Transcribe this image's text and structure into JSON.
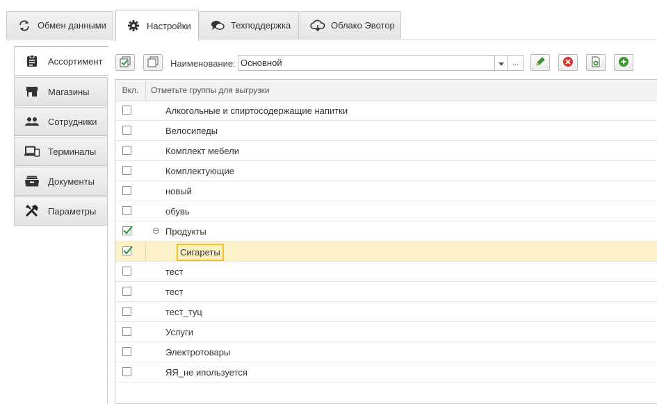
{
  "top_tabs": [
    {
      "label": "Обмен данными",
      "icon": "sync-icon"
    },
    {
      "label": "Настройки",
      "icon": "gear-icon",
      "active": true
    },
    {
      "label": "Техподдержка",
      "icon": "chat-icon"
    },
    {
      "label": "Облако Эвотор",
      "icon": "cloud-icon"
    }
  ],
  "side_tabs": [
    {
      "label": "Ассортимент",
      "icon": "clipboard-icon",
      "active": true
    },
    {
      "label": "Магазины",
      "icon": "store-icon"
    },
    {
      "label": "Сотрудники",
      "icon": "people-icon"
    },
    {
      "label": "Терминалы",
      "icon": "devices-icon"
    },
    {
      "label": "Документы",
      "icon": "archive-icon"
    },
    {
      "label": "Параметры",
      "icon": "tools-icon"
    }
  ],
  "toolbar": {
    "name_label": "Наименование:",
    "name_value": "Основной",
    "more_label": "...",
    "check_all_icon": "check-all-icon",
    "uncheck_all_icon": "uncheck-all-icon",
    "edit_icon": "pencil-icon",
    "delete_icon": "delete-icon",
    "copy_icon": "copy-doc-icon",
    "add_icon": "add-icon"
  },
  "grid": {
    "col_enabled": "Вкл.",
    "col_groups": "Отметьте группы для выгрузки",
    "rows": [
      {
        "label": "Алкогольные и спиртосодержащие напитки",
        "checked": false,
        "level": 0
      },
      {
        "label": "Велосипеды",
        "checked": false,
        "level": 0
      },
      {
        "label": "Комплект мебели",
        "checked": false,
        "level": 0
      },
      {
        "label": "Комплектующие",
        "checked": false,
        "level": 0
      },
      {
        "label": "новый",
        "checked": false,
        "level": 0
      },
      {
        "label": "обувь",
        "checked": false,
        "level": 0
      },
      {
        "label": "Продукты",
        "checked": true,
        "level": 0,
        "expanded": true
      },
      {
        "label": "Сигареты",
        "checked": true,
        "level": 1,
        "selected": true
      },
      {
        "label": "тест",
        "checked": false,
        "level": 0
      },
      {
        "label": "тест",
        "checked": false,
        "level": 0
      },
      {
        "label": "тест_туц",
        "checked": false,
        "level": 0
      },
      {
        "label": "Услуги",
        "checked": false,
        "level": 0
      },
      {
        "label": "Электротовары",
        "checked": false,
        "level": 0
      },
      {
        "label": "ЯЯ_не ипользуется",
        "checked": false,
        "level": 0
      }
    ]
  },
  "colors": {
    "accent_green": "#2e9a3a",
    "selection": "#fbf2c9",
    "focus_border": "#f0c331"
  }
}
